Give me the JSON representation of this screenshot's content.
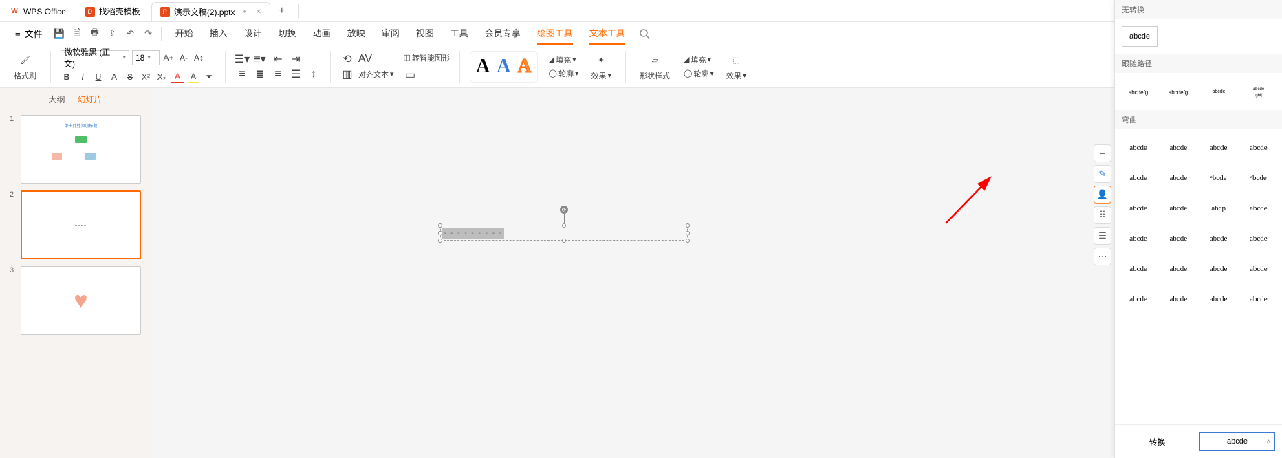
{
  "titlebar": {
    "app": "WPS Office",
    "tabs": [
      {
        "icon": "doc",
        "label": "找稻壳模板"
      },
      {
        "icon": "ppt",
        "label": "演示文稿(2).pptx",
        "active": true,
        "dirty": "•"
      }
    ],
    "add": "+"
  },
  "menubar": {
    "hamburger": "≡",
    "file": "文件",
    "menus": [
      "开始",
      "插入",
      "设计",
      "切换",
      "动画",
      "放映",
      "审阅",
      "视图",
      "工具",
      "会员专享",
      "绘图工具",
      "文本工具"
    ],
    "active_indices": [
      10,
      11
    ]
  },
  "ribbon": {
    "format_painter": "格式刷",
    "font_name": "微软雅黑 (正文)",
    "font_size": "18",
    "buttons_row1": [
      "A+",
      "A-",
      "A↕"
    ],
    "buttons_row2": [
      "B",
      "I",
      "U",
      "A",
      "S",
      "X²",
      "X₂",
      "A▾",
      "A▾",
      "⏷"
    ],
    "smart_graphic": "转智能图形",
    "align_text": "对齐文本",
    "fill": "填充",
    "outline": "轮廓",
    "effect": "效果",
    "shape_style": "形状样式",
    "outline2": "轮廓",
    "effect2": "效果",
    "fill2": "填充"
  },
  "sidepanel": {
    "tabs": [
      "大纲",
      "幻灯片"
    ],
    "active": 1,
    "slides": [
      {
        "num": "1",
        "title": "单击此处添加标题"
      },
      {
        "num": "2",
        "selected": true
      },
      {
        "num": "3",
        "heart": true
      }
    ]
  },
  "canvas": {
    "textbox_text": "- - - - - - - - -"
  },
  "float_tools": [
    "−",
    "✎",
    "👤",
    "⠿",
    "☰",
    "⋯"
  ],
  "rightpanel": {
    "section1": "无转换",
    "none_label": "abcde",
    "section2": "跟随路径",
    "path_items": [
      "∿",
      "∿",
      "○",
      "○"
    ],
    "section3": "弯曲",
    "warp_items": [
      "abcde",
      "abcde",
      "abcde",
      "abcde",
      "abcde",
      "abcde",
      "ᵃbcde",
      "ᵃbcde",
      "abcde",
      "abcde",
      "abcp",
      "abcde",
      "abcde",
      "abcde",
      "abcde",
      "abcde",
      "abcde",
      "abcde",
      "abcde",
      "abcde",
      "abcde",
      "abcde",
      "abcde",
      "abcde"
    ],
    "foot_label": "转换",
    "foot_value": "abcde"
  }
}
